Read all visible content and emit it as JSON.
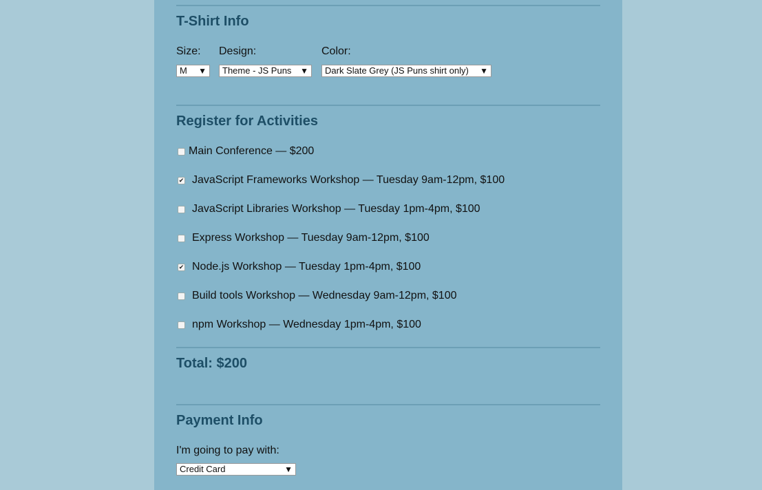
{
  "tshirt": {
    "heading": "T-Shirt Info",
    "size_label": "Size:",
    "size_value": "M",
    "design_label": "Design:",
    "design_value": "Theme - JS Puns",
    "color_label": "Color:",
    "color_value": "Dark Slate Grey (JS Puns shirt only)"
  },
  "activities": {
    "heading": "Register for Activities",
    "items": [
      {
        "label": "Main Conference — $200",
        "checked": false
      },
      {
        "label": "JavaScript Frameworks Workshop — Tuesday 9am-12pm, $100",
        "checked": true
      },
      {
        "label": "JavaScript Libraries Workshop — Tuesday 1pm-4pm, $100",
        "checked": false
      },
      {
        "label": "Express Workshop — Tuesday 9am-12pm, $100",
        "checked": false
      },
      {
        "label": "Node.js Workshop — Tuesday 1pm-4pm, $100",
        "checked": true
      },
      {
        "label": "Build tools Workshop — Wednesday 9am-12pm, $100",
        "checked": false
      },
      {
        "label": "npm Workshop — Wednesday 1pm-4pm, $100",
        "checked": false
      }
    ],
    "total": "Total: $200"
  },
  "payment": {
    "heading": "Payment Info",
    "pay_label": "I'm going to pay with:",
    "pay_value": "Credit Card"
  },
  "icons": {
    "dropdown_arrow": "▼",
    "checkmark": "✔"
  },
  "colors": {
    "page_bg": "#a9cad7",
    "panel_bg": "#85b5ca",
    "heading": "#1d4e66"
  }
}
